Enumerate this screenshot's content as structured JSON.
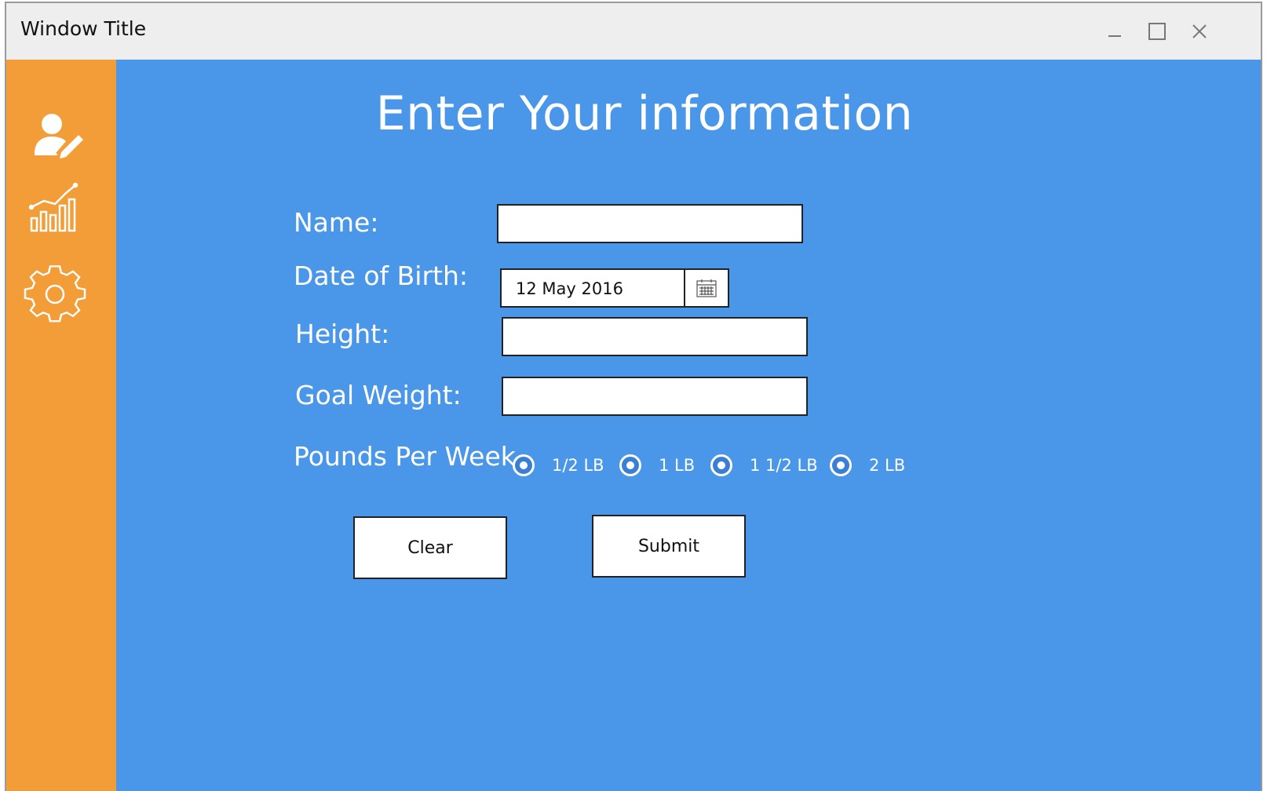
{
  "window": {
    "title": "Window Title",
    "controls": {
      "minimize": "minimize-icon",
      "maximize": "maximize-icon",
      "close": "close-icon"
    }
  },
  "sidebar": {
    "items": [
      {
        "icon": "user-edit-icon"
      },
      {
        "icon": "chart-growth-icon"
      },
      {
        "icon": "gear-icon"
      }
    ],
    "color": "#f29d38"
  },
  "main": {
    "background": "#4a96e9",
    "heading": "Enter Your information",
    "fields": {
      "name_label": "Name:",
      "name_value": "",
      "dob_label": "Date of Birth:",
      "dob_value": "12 May 2016",
      "height_label": "Height:",
      "height_value": "",
      "goal_label": "Goal Weight:",
      "goal_value": ""
    },
    "pounds_per_week": {
      "label": "Pounds Per Week",
      "options": [
        "1/2 LB",
        "1 LB",
        "1 1/2 LB",
        "2 LB"
      ]
    },
    "buttons": {
      "clear": "Clear",
      "submit": "Submit"
    }
  }
}
